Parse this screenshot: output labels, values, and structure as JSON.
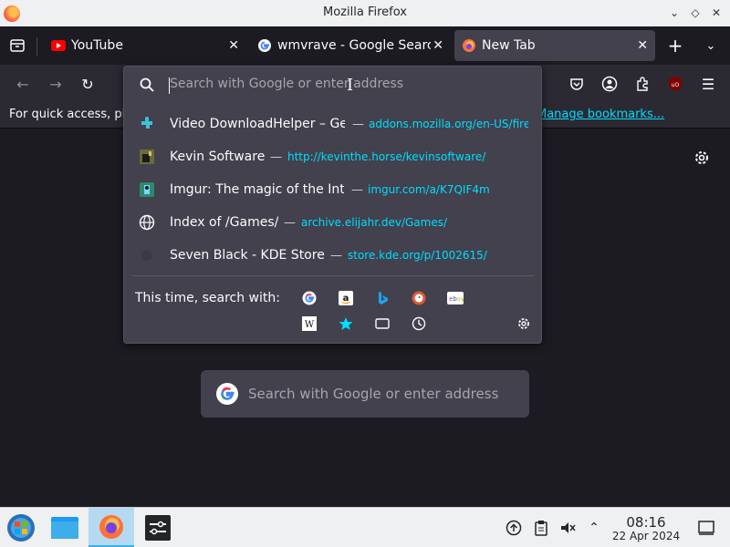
{
  "window": {
    "title": "Mozilla Firefox"
  },
  "tabs": [
    {
      "label": "YouTube",
      "icon": "youtube-icon"
    },
    {
      "label": "wmvrave - Google Search",
      "icon": "google-icon"
    },
    {
      "label": "New Tab",
      "icon": "firefox-icon",
      "active": true
    }
  ],
  "bookmarks_bar": {
    "text": "For quick access, place your bookmarks here on the bookmarks toolbar.",
    "link": "Manage bookmarks..."
  },
  "urlbar": {
    "placeholder": "Search with Google or enter address",
    "results": [
      {
        "title": "Video DownloadHelper – Get this Extension for 🦊 Firefox",
        "url": "addons.mozilla.org/en-US/firefox/addon/video-downloadhelper/",
        "icon": "puzzle-icon"
      },
      {
        "title": "Kevin Software",
        "url": "http://kevinthe.horse/kevinsoftware/",
        "icon": "site-favicon"
      },
      {
        "title": "Imgur: The magic of the Internet",
        "url": "imgur.com/a/K7QIF4m",
        "icon": "imgur-icon"
      },
      {
        "title": "Index of /Games/",
        "url": "archive.elijahr.dev/Games/",
        "icon": "globe-icon"
      },
      {
        "title": "Seven Black - KDE Store",
        "url": "store.kde.org/p/1002615/",
        "icon": "kde-store-icon"
      }
    ],
    "dash": "—",
    "search_with_label": "This time, search with:",
    "engines": [
      "google",
      "amazon",
      "bing",
      "duckduckgo",
      "ebay",
      "wikipedia",
      "bookmarks",
      "tabs",
      "history"
    ]
  },
  "newtab": {
    "search_placeholder": "Search with Google or enter address"
  },
  "taskbar": {
    "time": "08:16",
    "date": "22 Apr 2024"
  },
  "colors": {
    "accent": "#00ddff",
    "panel": "#42414d",
    "toolbar": "#2b2a33",
    "background": "#1c1b22"
  }
}
